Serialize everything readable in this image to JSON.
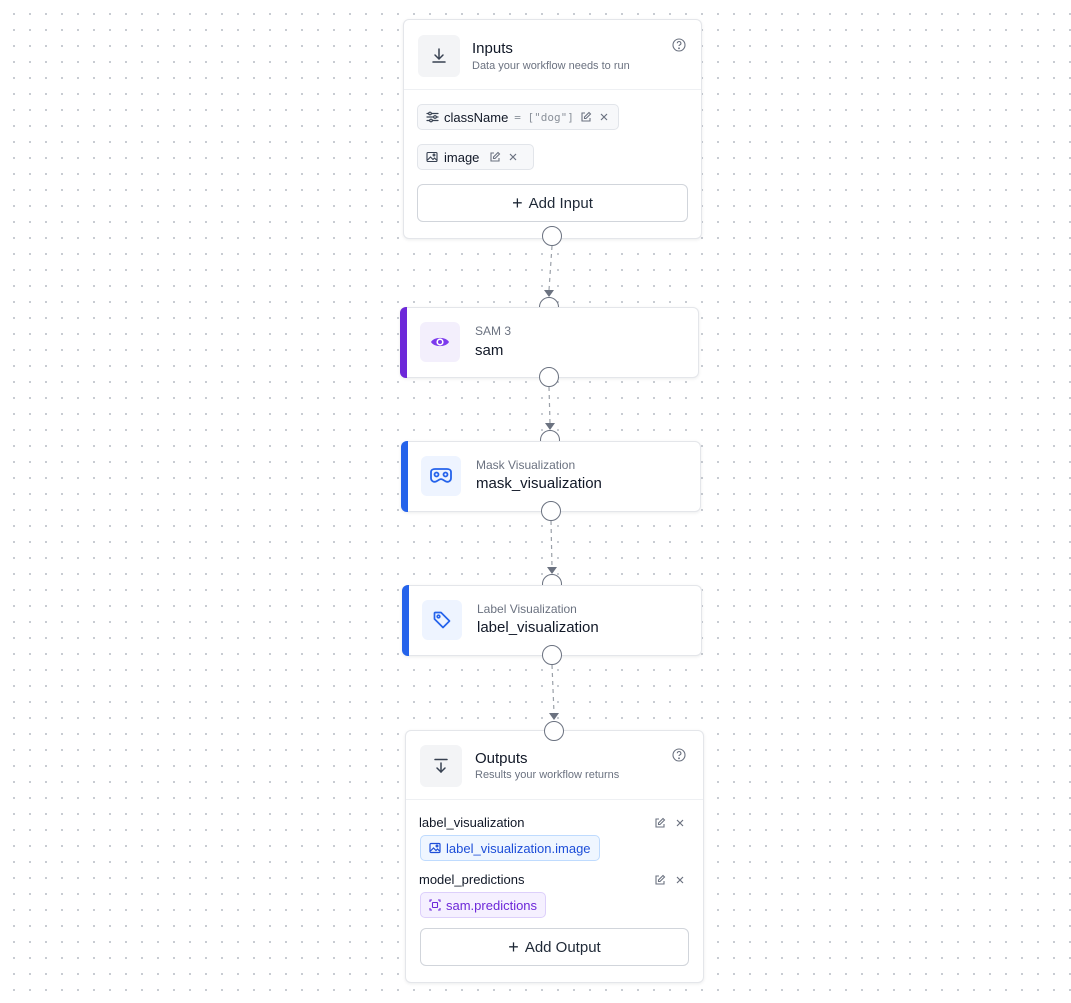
{
  "inputs": {
    "title": "Inputs",
    "subtitle": "Data your workflow needs to run",
    "items": [
      {
        "icon": "sliders-icon",
        "name": "className",
        "default": "= [\"dog\"]"
      },
      {
        "icon": "image-icon",
        "name": "image",
        "default": ""
      }
    ],
    "add_label": "Add Input"
  },
  "nodes": [
    {
      "type": "SAM 3",
      "name": "sam",
      "icon": "eye-icon",
      "accent": "#6d28d9",
      "icon_bg": "#f3effc",
      "icon_color": "#7c3aed"
    },
    {
      "type": "Mask Visualization",
      "name": "mask_visualization",
      "icon": "mask-icon",
      "accent": "#2563eb",
      "icon_bg": "#eef4ff",
      "icon_color": "#2563eb"
    },
    {
      "type": "Label Visualization",
      "name": "label_visualization",
      "icon": "tag-icon",
      "accent": "#2563eb",
      "icon_bg": "#eef4ff",
      "icon_color": "#2563eb"
    }
  ],
  "outputs": {
    "title": "Outputs",
    "subtitle": "Results your workflow returns",
    "items": [
      {
        "label": "label_visualization",
        "value": "label_visualization.image",
        "style": "blue",
        "icon": "image-icon"
      },
      {
        "label": "model_predictions",
        "value": "sam.predictions",
        "style": "purple",
        "icon": "predictions-icon"
      }
    ],
    "add_label": "Add Output"
  }
}
